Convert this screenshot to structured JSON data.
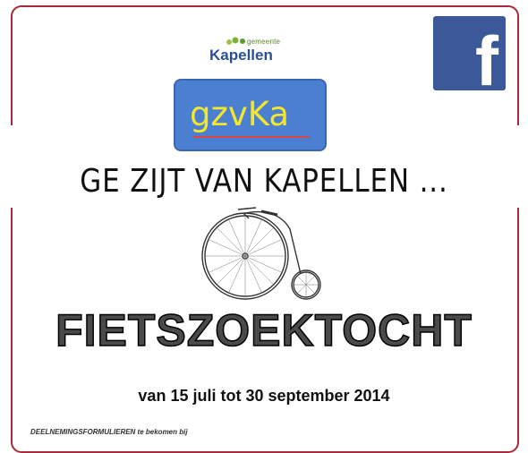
{
  "logo": {
    "line_small": "gemeente",
    "line_big": "Kapellen"
  },
  "facebook": {
    "glyph": "f",
    "icon": "facebook-icon",
    "color": "#3b5998"
  },
  "badge": {
    "text": "gzvKa",
    "bg_color": "#4b7fd1",
    "text_color": "#f4e62a"
  },
  "heading": "GE ZIJT  VAN KAPELLEN ...",
  "title": "FIETSZOEKTOCHT",
  "dates": "van 15 juli tot 30 september 2014",
  "footer": "DEELNEMINGSFORMULIEREN te bekomen bij"
}
